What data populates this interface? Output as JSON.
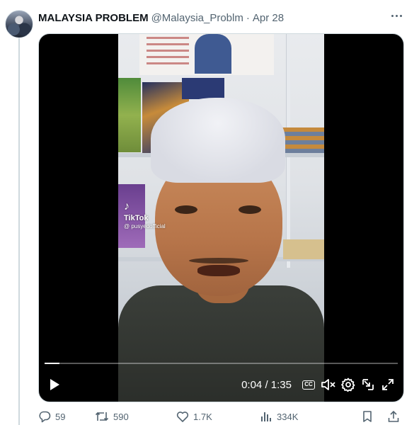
{
  "tweet": {
    "display_name": "MALAYSIA PROBLEM",
    "handle": "@Malaysia_Problm",
    "separator": "·",
    "date": "Apr 28"
  },
  "video": {
    "watermark_brand": "TikTok",
    "watermark_user": "@ pusyedofficial",
    "current_time": "0:04",
    "time_separator": "/",
    "duration": "1:35",
    "progress_fraction": 0.042,
    "cc_label": "CC"
  },
  "actions": {
    "replies": "59",
    "reposts": "590",
    "likes": "1.7K",
    "views": "334K"
  },
  "colors": {
    "muted_text": "#536471",
    "primary_text": "#0f1419",
    "thread_line": "#cfd9de"
  },
  "icons": [
    "more-icon",
    "play-icon",
    "cc-icon",
    "mute-icon",
    "settings-icon",
    "exit-fullscreen-icon",
    "fullscreen-icon",
    "reply-icon",
    "repost-icon",
    "like-icon",
    "views-icon",
    "bookmark-icon",
    "share-icon"
  ]
}
